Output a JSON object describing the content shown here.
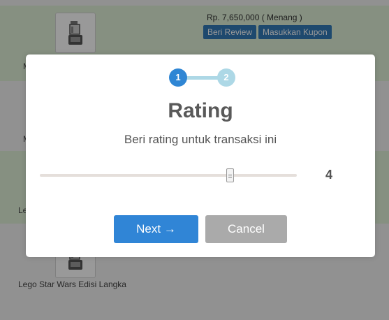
{
  "background": {
    "rows": [
      {
        "name": "M",
        "price": "Rp. 7,650,000 ( Menang )",
        "review_label": "Beri Review",
        "kupon_label": "Masukkan Kupon"
      },
      {
        "name": "M"
      },
      {
        "name": "Le"
      },
      {
        "name": "Lego Star Wars Edisi Langka"
      }
    ]
  },
  "modal": {
    "steps": [
      "1",
      "2"
    ],
    "active_step": 1,
    "title": "Rating",
    "subtitle": "Beri rating untuk transaksi ini",
    "rating": {
      "value": "4",
      "min": 0,
      "max": 5
    },
    "next_label": "Next →",
    "cancel_label": "Cancel"
  },
  "colors": {
    "row_won": "#dff0d8",
    "action_button": "#337ab7",
    "step_active": "#2f86d4",
    "step_inactive": "#add8e6",
    "next_button": "#3085d6",
    "cancel_button": "#aaaaaa",
    "overlay": "rgba(0,0,0,0.4)"
  },
  "icons": {
    "product": "appliance-icon"
  }
}
